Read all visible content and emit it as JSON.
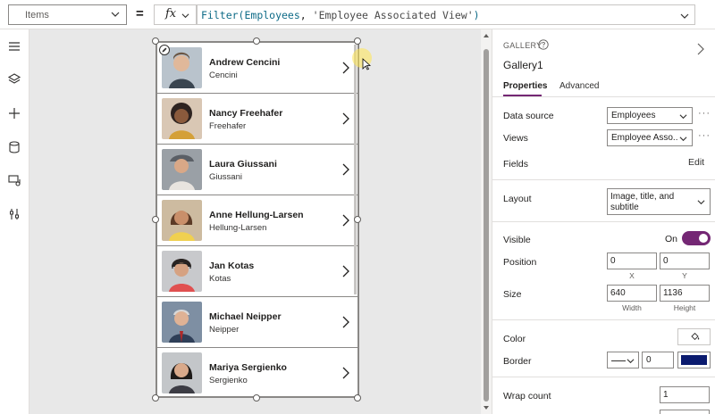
{
  "formula_bar": {
    "property": "Items",
    "equals": "=",
    "fx": "fx",
    "formula_fn": "Filter(",
    "formula_arg": "Employees",
    "formula_sep": ", ",
    "formula_str": "'Employee Associated View'",
    "formula_end": ")"
  },
  "gallery": {
    "rows": [
      {
        "title": "Andrew Cencini",
        "subtitle": "Cencini",
        "avatar_bg": "#b9c3cc"
      },
      {
        "title": "Nancy Freehafer",
        "subtitle": "Freehafer",
        "avatar_bg": "#d9c7b4"
      },
      {
        "title": "Laura Giussani",
        "subtitle": "Giussani",
        "avatar_bg": "#9aa0a6"
      },
      {
        "title": "Anne Hellung-Larsen",
        "subtitle": "Hellung-Larsen",
        "avatar_bg": "#cdbba0"
      },
      {
        "title": "Jan Kotas",
        "subtitle": "Kotas",
        "avatar_bg": "#c8c9cc"
      },
      {
        "title": "Michael Neipper",
        "subtitle": "Neipper",
        "avatar_bg": "#7e8fa3"
      },
      {
        "title": "Mariya Sergienko",
        "subtitle": "Sergienko",
        "avatar_bg": "#c3c6c9"
      }
    ]
  },
  "panel": {
    "type_label": "GALLERY",
    "control_name": "Gallery1",
    "tabs": [
      {
        "label": "Properties"
      },
      {
        "label": "Advanced"
      }
    ],
    "data_source": {
      "label": "Data source",
      "value": "Employees",
      "more": "···"
    },
    "views": {
      "label": "Views",
      "value": "Employee Asso...",
      "more": "···"
    },
    "fields": {
      "label": "Fields",
      "action": "Edit"
    },
    "layout": {
      "label": "Layout",
      "value": "Image, title, and subtitle"
    },
    "visible": {
      "label": "Visible",
      "state": "On"
    },
    "position": {
      "label": "Position",
      "x": "0",
      "y": "0",
      "x_caption": "X",
      "y_caption": "Y"
    },
    "size": {
      "label": "Size",
      "width": "640",
      "height": "1136",
      "width_caption": "Width",
      "height_caption": "Height"
    },
    "color": {
      "label": "Color"
    },
    "border": {
      "label": "Border",
      "width": "0",
      "color": "#0a1a6e"
    },
    "wrap_count": {
      "label": "Wrap count",
      "value": "1"
    }
  },
  "colors": {
    "accent": "#742774",
    "canvas_bg": "#e8e8e8"
  }
}
